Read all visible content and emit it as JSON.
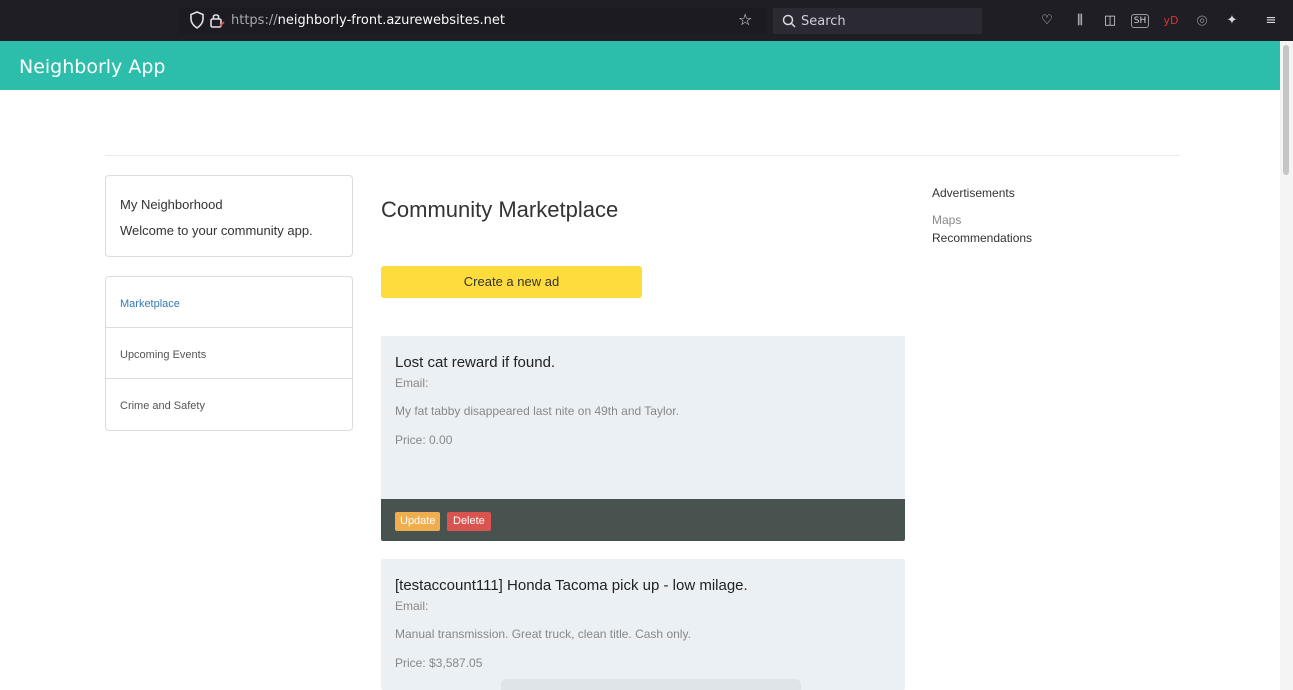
{
  "browser": {
    "url_protocol": "https://",
    "url_host": "neighborly-front.azurewebsites.net",
    "search_placeholder": "Search",
    "toolbar_badges": {
      "extension1": "SH",
      "extension2": "yD"
    }
  },
  "app": {
    "brand": "Neighborly App",
    "accent_color": "#2dbdab"
  },
  "welcome_panel": {
    "title": "My Neighborhood",
    "subtitle": "Welcome to your community app."
  },
  "menu": {
    "items": [
      {
        "label": "Marketplace",
        "active": true
      },
      {
        "label": "Upcoming Events",
        "active": false
      },
      {
        "label": "Crime and Safety",
        "active": false
      }
    ]
  },
  "main": {
    "title": "Community Marketplace",
    "create_button": "Create a new ad",
    "ads": [
      {
        "title": "Lost cat reward if found.",
        "email_label": "Email:",
        "description": "My fat tabby disappeared last nite on 49th and Taylor.",
        "price": "Price: 0.00",
        "update_label": "Update",
        "delete_label": "Delete"
      },
      {
        "title": "[testaccount111] Honda Tacoma pick up - low milage.",
        "email_label": "Email:",
        "description": "Manual transmission. Great truck, clean title. Cash only.",
        "price": "Price: $3,587.05"
      }
    ]
  },
  "sidebar": {
    "links": [
      "Advertisements",
      "Maps",
      "Recommendations"
    ]
  }
}
